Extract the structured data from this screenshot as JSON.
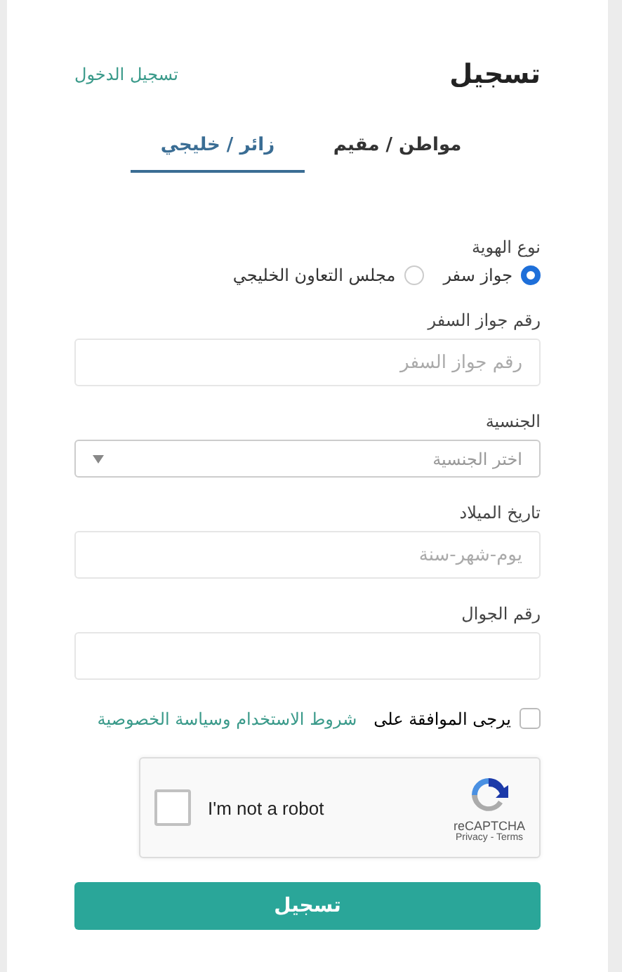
{
  "header": {
    "title": "تسجيل",
    "login_link": "تسجيل الدخول"
  },
  "tabs": [
    {
      "label": "مواطن / مقيم",
      "selected": false
    },
    {
      "label": "زائر / خليجي",
      "selected": true
    }
  ],
  "identity_type": {
    "label": "نوع الهوية",
    "options": [
      {
        "label": "جواز سفر",
        "selected": true
      },
      {
        "label": "مجلس التعاون الخليجي",
        "selected": false
      }
    ]
  },
  "fields": [
    {
      "kind": "input",
      "label": "رقم جواز السفر",
      "placeholder": "رقم جواز السفر"
    },
    {
      "kind": "select",
      "label": "الجنسية",
      "placeholder": "اختر الجنسية"
    },
    {
      "kind": "input",
      "label": "تاريخ الميلاد",
      "placeholder": "يوم-شهر-سنة"
    },
    {
      "kind": "input",
      "label": "رقم الجوال"
    }
  ],
  "agreement": {
    "checked": false,
    "text": "يرجى الموافقة على",
    "link": "شروط الاستخدام وسياسة الخصوصية"
  },
  "captcha": {
    "checked": false,
    "label": "I'm not a robot",
    "brand": "reCAPTCHA",
    "links": "Privacy - Terms"
  },
  "submit": "تسجيل"
}
